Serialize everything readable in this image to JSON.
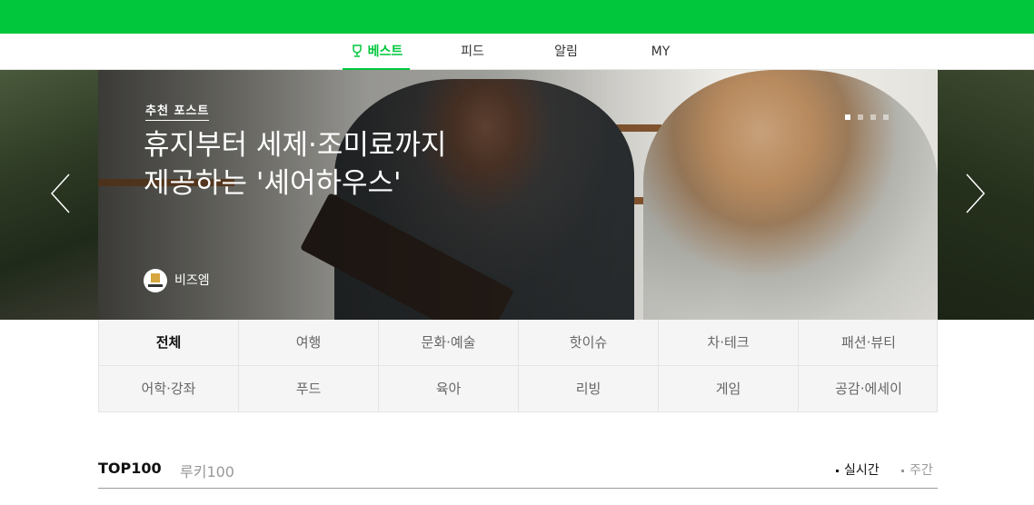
{
  "nav": {
    "tabs": [
      {
        "label": "베스트",
        "active": true,
        "icon": "trophy-icon"
      },
      {
        "label": "피드",
        "active": false
      },
      {
        "label": "알림",
        "active": false
      },
      {
        "label": "MY",
        "active": false
      }
    ]
  },
  "hero": {
    "label": "추천 포스트",
    "title_line1": "휴지부터 세제·조미료까지",
    "title_line2": "제공하는 '셰어하우스'",
    "source_name": "비즈엠",
    "slide_count": 4,
    "active_slide": 1
  },
  "categories": [
    [
      "전체",
      "여행",
      "문화·예술",
      "핫이슈",
      "차·테크",
      "패션·뷰티"
    ],
    [
      "어학·강좌",
      "푸드",
      "육아",
      "리빙",
      "게임",
      "공감·에세이"
    ]
  ],
  "active_category": "전체",
  "ranking": {
    "tab_top": "TOP100",
    "tab_rookie": "루키100",
    "period_realtime": "실시간",
    "period_weekly": "주간"
  },
  "colors": {
    "brand_green": "#00c73c",
    "text_dark": "#111111",
    "text_muted": "#999999"
  }
}
